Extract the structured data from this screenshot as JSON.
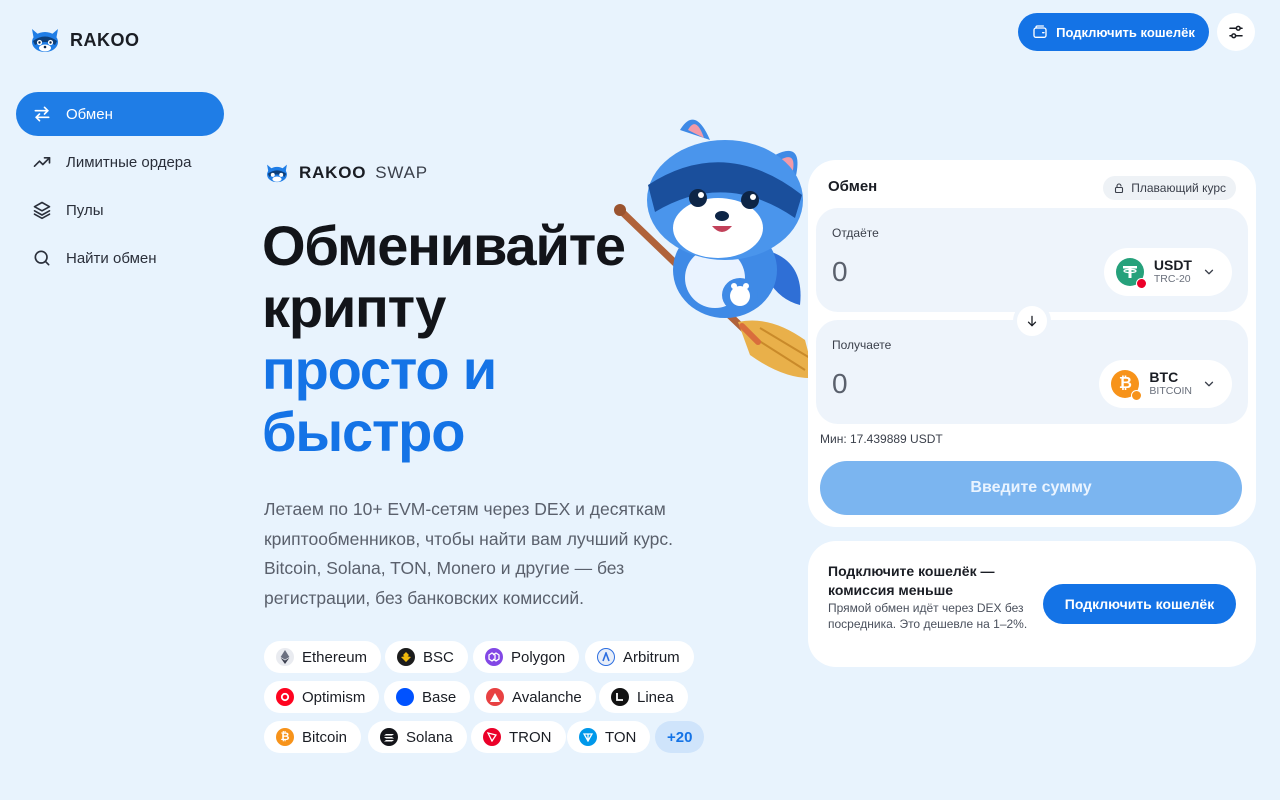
{
  "brand": {
    "name": "RAKOO"
  },
  "header": {
    "connect_wallet_label": "Подключить кошелёк"
  },
  "sidebar": {
    "items": [
      {
        "label": "Обмен",
        "icon": "swap-arrows-icon",
        "active": true
      },
      {
        "label": "Лимитные ордера",
        "icon": "trend-up-icon",
        "active": false
      },
      {
        "label": "Пулы",
        "icon": "layers-icon",
        "active": false
      },
      {
        "label": "Найти обмен",
        "icon": "search-icon",
        "active": false
      }
    ]
  },
  "hero": {
    "brand_primary": "RAKOO",
    "brand_secondary": "SWAP",
    "headline_line1": "Обменивайте",
    "headline_line2": "крипту",
    "headline_line3": "просто и",
    "headline_line4": "быстро",
    "description": "Летаем по 10+ EVM-сетям через DEX и десяткам криптообменников, чтобы найти вам лучший курс. Bitcoin, Solana, TON, Monero и другие — без регистрации, без банковских комиссий."
  },
  "chains": [
    {
      "label": "Ethereum",
      "color": "#8a92a6"
    },
    {
      "label": "BSC",
      "color": "#f0b90b"
    },
    {
      "label": "Polygon",
      "color": "#8247e5"
    },
    {
      "label": "Arbitrum",
      "color": "#2d6ee0"
    },
    {
      "label": "Optimism",
      "color": "#ff0420"
    },
    {
      "label": "Base",
      "color": "#0052ff"
    },
    {
      "label": "Avalanche",
      "color": "#e84142"
    },
    {
      "label": "Linea",
      "color": "#121212"
    },
    {
      "label": "Bitcoin",
      "color": "#f7931a"
    },
    {
      "label": "Solana",
      "color": "#14151a"
    },
    {
      "label": "TRON",
      "color": "#eb0029"
    },
    {
      "label": "TON",
      "color": "#0098ea"
    },
    {
      "label": "+20",
      "color": "#1473e6"
    }
  ],
  "swap": {
    "title": "Обмен",
    "rate_mode": "Плавающий курс",
    "give": {
      "label": "Отдаёте",
      "amount_placeholder": "0",
      "token": "USDT",
      "network": "TRC-20",
      "token_color": "#26a17b",
      "badge_color": "#eb0029"
    },
    "receive": {
      "label": "Получаете",
      "amount_placeholder": "0",
      "token": "BTC",
      "network": "BITCOIN",
      "token_color": "#f7931a",
      "badge_color": "#f7931a"
    },
    "min_text": "Мин: 17.439889 USDT",
    "cta_label": "Введите сумму"
  },
  "promo": {
    "title": "Подключите кошелёк — комиссия меньше",
    "text": "Прямой обмен идёт через DEX без посредника. Это дешевле на 1–2%.",
    "button_label": "Подключить кошелёк"
  },
  "colors": {
    "background": "#e8f3fd",
    "accent": "#1473e6",
    "cta_disabled": "#7bb5f0"
  }
}
